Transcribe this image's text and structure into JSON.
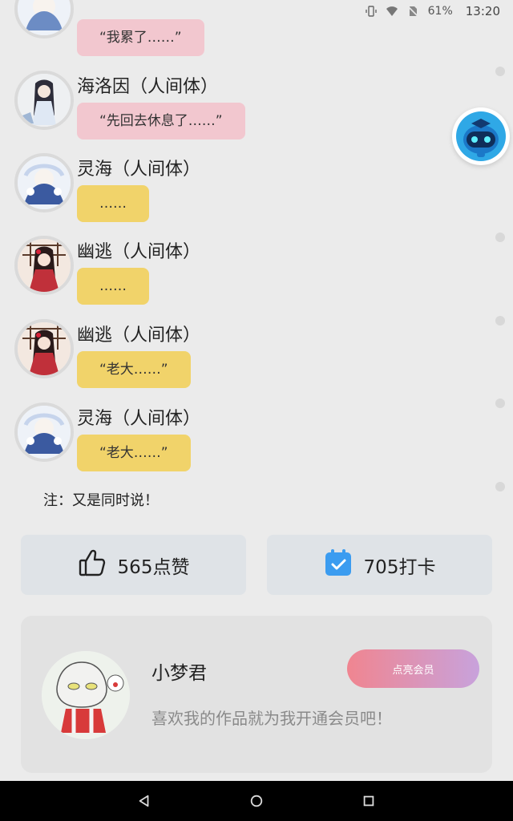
{
  "status_bar": {
    "battery": "61%",
    "time": "13:20"
  },
  "messages": [
    {
      "speaker": "",
      "text": "“我累了……”",
      "style": "pink",
      "avatar": "snow-girl-avatar"
    },
    {
      "speaker": "海洛因（人间体）",
      "text": "“先回去休息了……”",
      "style": "pink",
      "avatar": "dark-hair-girl-avatar"
    },
    {
      "speaker": "灵海（人间体）",
      "text": "……",
      "style": "yellow",
      "avatar": "snow-girl-avatar"
    },
    {
      "speaker": "幽逃（人间体）",
      "text": "……",
      "style": "yellow",
      "avatar": "red-kimono-girl-avatar"
    },
    {
      "speaker": "幽逃（人间体）",
      "text": "“老大……”",
      "style": "yellow",
      "avatar": "red-kimono-girl-avatar"
    },
    {
      "speaker": "灵海（人间体）",
      "text": "“老大……”",
      "style": "yellow",
      "avatar": "snow-girl-avatar"
    }
  ],
  "note": "注：又是同时说！",
  "actions": {
    "like_label": "565点赞",
    "checkin_label": "705打卡"
  },
  "member": {
    "name": "小梦君",
    "description": "喜欢我的作品就为我开通会员吧！",
    "button_label": "点亮会员"
  },
  "colors": {
    "pink_bubble": "#f2c7cf",
    "yellow_bubble": "#f1d36a",
    "checkin_blue": "#3b9cf0"
  }
}
